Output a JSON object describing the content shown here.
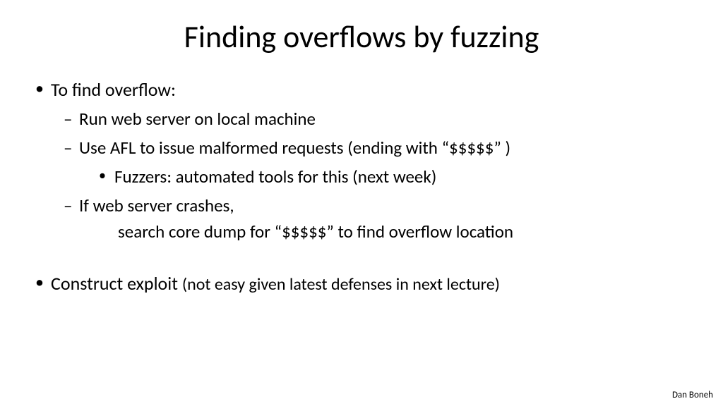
{
  "title": "Finding overflows by fuzzing",
  "bullets": {
    "b1": "To find overflow:",
    "b1_1": "Run web server on local machine",
    "b1_2": "Use AFL to issue malformed requests (ending with   “$$$$$” )",
    "b1_2_1": "Fuzzers:  automated tools for this (next week)",
    "b1_3": "If web server crashes,",
    "b1_3_sub": "search core dump for  “$$$$$” to find overflow location",
    "b2": "Construct exploit    ",
    "b2_note": "(not easy given latest defenses in next lecture)"
  },
  "author": "Dan Boneh"
}
